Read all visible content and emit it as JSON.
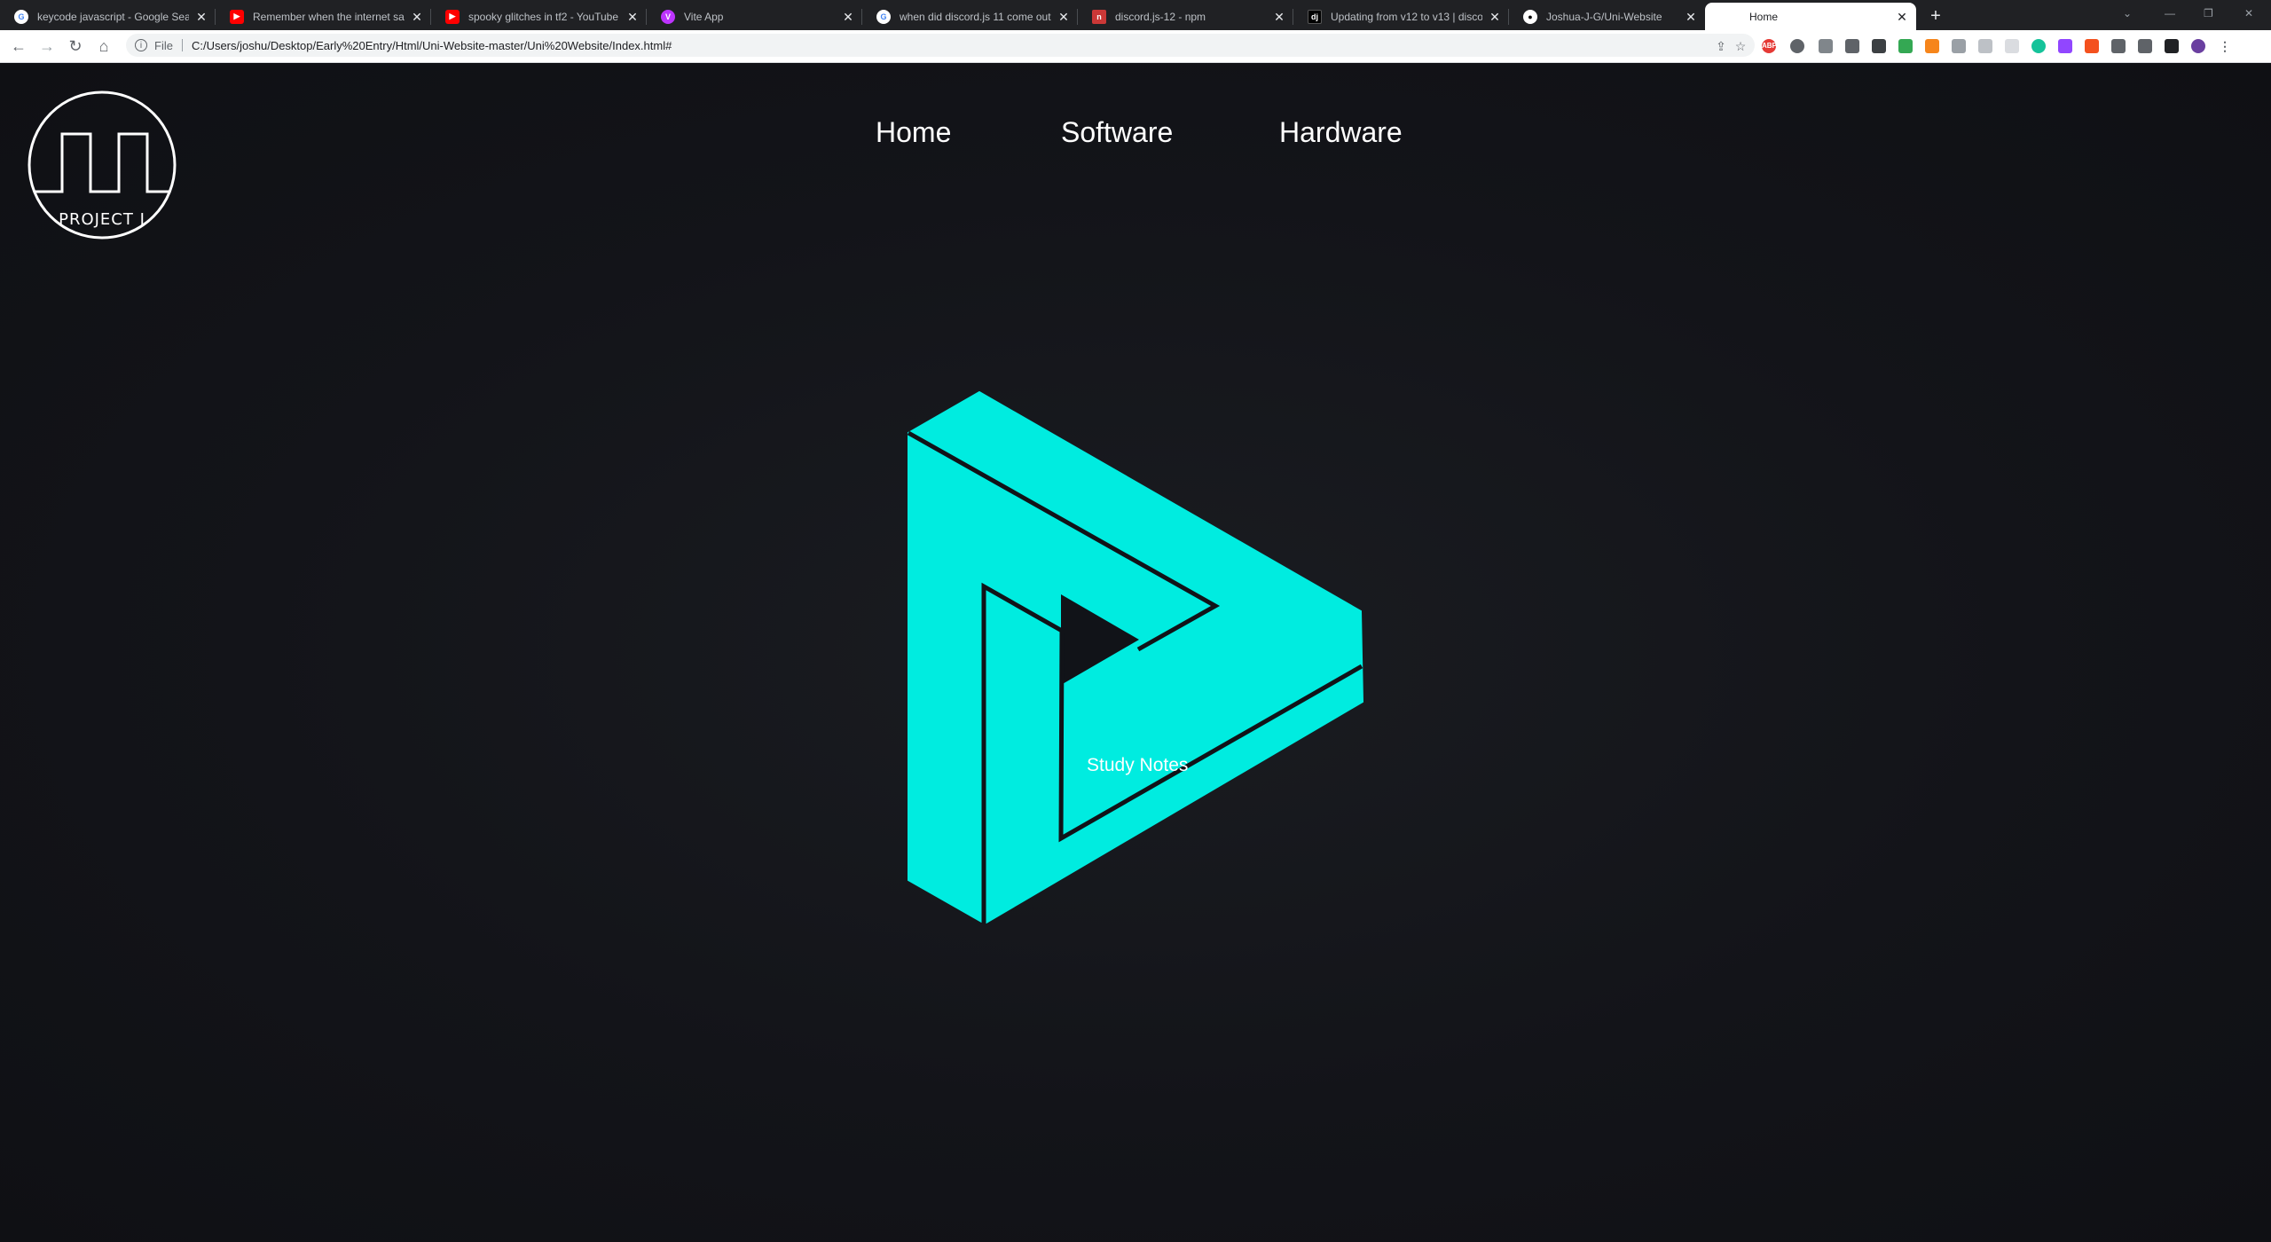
{
  "browser": {
    "tabs": [
      {
        "title": "keycode javascript - Google Sea",
        "favicon": "google-icon",
        "color": "#ffffff"
      },
      {
        "title": "Remember when the internet sa",
        "favicon": "youtube-icon",
        "color": "#ff0000"
      },
      {
        "title": "spooky glitches in tf2 - YouTube",
        "favicon": "youtube-icon",
        "color": "#ff0000"
      },
      {
        "title": "Vite App",
        "favicon": "vite-icon",
        "color": "#bd34fe"
      },
      {
        "title": "when did discord.js 11 come out",
        "favicon": "google-icon",
        "color": "#ffffff"
      },
      {
        "title": "discord.js-12 - npm",
        "favicon": "npm-icon",
        "color": "#cb3837"
      },
      {
        "title": "Updating from v12 to v13 | disco",
        "favicon": "discordjs-icon",
        "color": "#000000"
      },
      {
        "title": "Joshua-J-G/Uni-Website",
        "favicon": "github-icon",
        "color": "#ffffff"
      },
      {
        "title": "Home",
        "favicon": "",
        "color": "#ffffff"
      }
    ],
    "new_tab_label": "+",
    "address": {
      "scheme": "File",
      "url": "C:/Users/joshu/Desktop/Early%20Entry/Html/Uni-Website-master/Uni%20Website/Index.html#"
    }
  },
  "site": {
    "logo_text": "PROJECT J",
    "nav": [
      "Home",
      "Software",
      "Hardware"
    ],
    "study_link": "Study Notes",
    "accent": "#00ece0"
  }
}
